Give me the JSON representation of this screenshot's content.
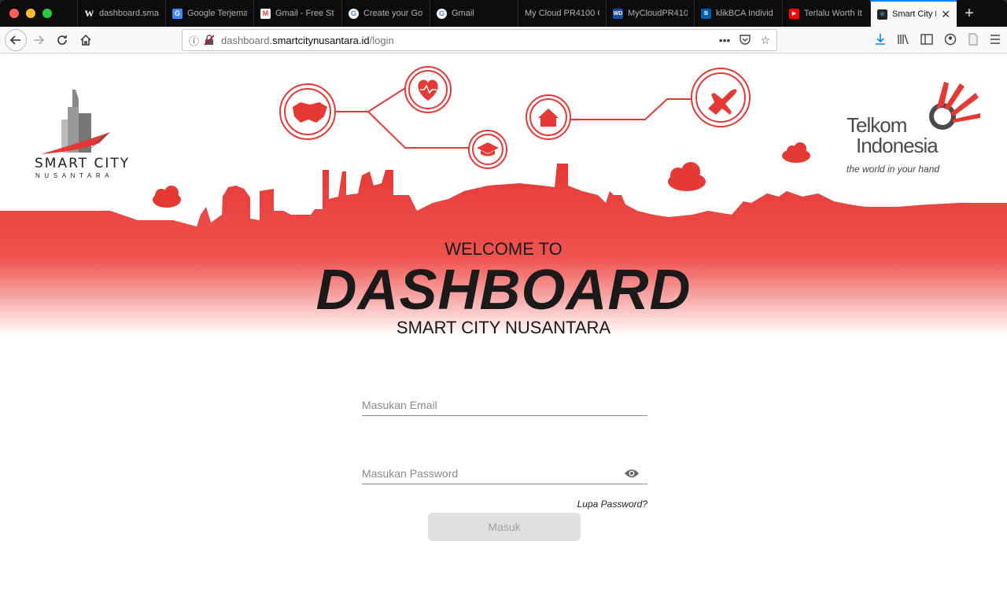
{
  "browser": {
    "tabs": [
      {
        "label": "dashboard.sma",
        "icon": "wikipedia-w-icon",
        "color": "#1f1f1f"
      },
      {
        "label": "Google Terjema",
        "icon": "google-translate-icon",
        "color": "#4285f4"
      },
      {
        "label": "Gmail - Free St",
        "icon": "gmail-icon",
        "color": "#ea4335"
      },
      {
        "label": "Create your Go",
        "icon": "google-icon",
        "color": "#4285f4"
      },
      {
        "label": "Gmail",
        "icon": "google-icon",
        "color": "#4285f4"
      },
      {
        "label": "My Cloud PR4100 C",
        "icon": "",
        "color": ""
      },
      {
        "label": "MyCloudPR410",
        "icon": "wd-icon",
        "color": "#1c4ba0"
      },
      {
        "label": "klikBCA Individ",
        "icon": "bca-icon",
        "color": "#0060af"
      },
      {
        "label": "Terlalu Worth It",
        "icon": "youtube-icon",
        "color": "#ff0000"
      }
    ],
    "active_tab": {
      "label": "Smart City N",
      "icon": "react-icon"
    },
    "url": {
      "prefix": "dashboard.",
      "domain": "smartcitynusantara.id",
      "path": "/login"
    }
  },
  "page": {
    "logo_left": {
      "line1": "SMART CITY",
      "line2": "NUSANTARA"
    },
    "logo_right": {
      "line1": "Telkom",
      "line2": "Indonesia",
      "tagline": "the world in your hand"
    },
    "welcome": "WELCOME TO",
    "title": "DASHBOARD",
    "subtitle": "SMART CITY NUSANTARA",
    "form": {
      "email_placeholder": "Masukan Email",
      "password_placeholder": "Masukan Password",
      "forgot_label": "Lupa Password?",
      "submit_label": "Masuk"
    },
    "colors": {
      "brand_red": "#e53935",
      "accent_blue": "#0a84ff"
    }
  }
}
